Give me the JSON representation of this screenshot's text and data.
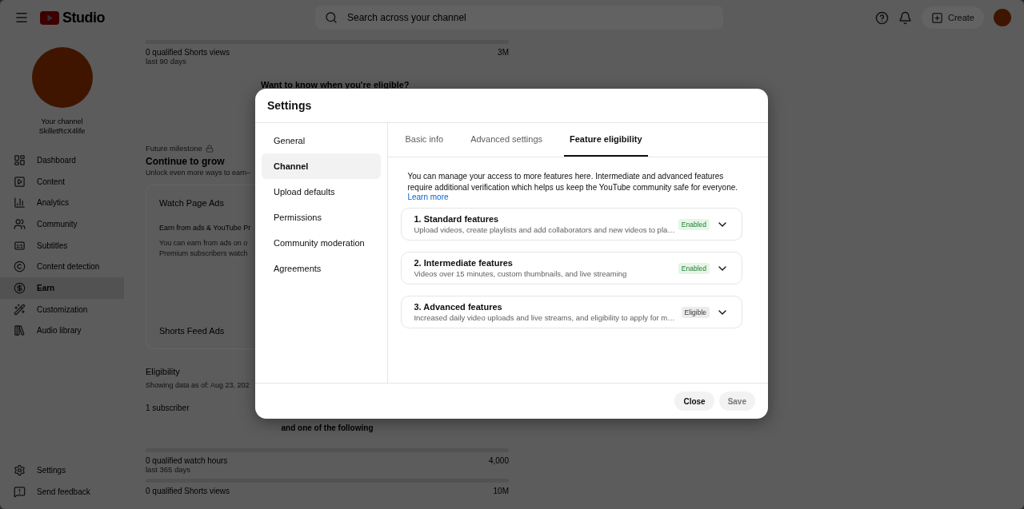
{
  "topbar": {
    "logo": "Studio",
    "search": {
      "placeholder": "Search across your channel"
    },
    "create": "Create"
  },
  "sidebar": {
    "channel_label": "Your channel",
    "channel_handle": "SkilletRcX4life",
    "items": [
      {
        "label": "Dashboard",
        "selected": false
      },
      {
        "label": "Content",
        "selected": false
      },
      {
        "label": "Analytics",
        "selected": false
      },
      {
        "label": "Community",
        "selected": false
      },
      {
        "label": "Subtitles",
        "selected": false
      },
      {
        "label": "Content detection",
        "selected": false
      },
      {
        "label": "Earn",
        "selected": true
      },
      {
        "label": "Customization",
        "selected": false
      },
      {
        "label": "Audio library",
        "selected": false
      }
    ],
    "footer_items": [
      {
        "label": "Settings"
      },
      {
        "label": "Send feedback"
      }
    ]
  },
  "main": {
    "top_metric": {
      "label": "0 qualified Shorts views",
      "period": "last 90 days",
      "target": "3M",
      "level": 0
    },
    "eligible_prompt": "Want to know when you're eligible?",
    "milestone": {
      "kicker": "Future milestone",
      "title": "Continue to grow",
      "subtitle": "Unlock even more ways to earn–"
    },
    "card": {
      "title": "Watch Page Ads",
      "subtitle": "Earn from ads & YouTube Pr",
      "body": [
        "You can earn from ads on o",
        "Premium subscribers watch"
      ],
      "footer": "Shorts Feed Ads"
    },
    "eligibility": {
      "title": "Eligibility",
      "date": "Showing data as of: Aug 23, 202",
      "subscribers": "1 subscriber",
      "separator": "and one of the following",
      "metrics": [
        {
          "label": "0 qualified watch hours",
          "period": "last 365 days",
          "target": "4,000",
          "level": 0
        },
        {
          "label": "0 qualified Shorts views",
          "target": "10M",
          "level": 0
        }
      ]
    }
  },
  "modal": {
    "title": "Settings",
    "nav": [
      {
        "label": "General",
        "selected": false
      },
      {
        "label": "Channel",
        "selected": true
      },
      {
        "label": "Upload defaults",
        "selected": false
      },
      {
        "label": "Permissions",
        "selected": false
      },
      {
        "label": "Community moderation",
        "selected": false
      },
      {
        "label": "Agreements",
        "selected": false
      }
    ],
    "tabs": [
      {
        "label": "Basic info",
        "selected": false
      },
      {
        "label": "Advanced settings",
        "selected": false
      },
      {
        "label": "Feature eligibility",
        "selected": true
      }
    ],
    "description": "You can manage your access to more features here. Intermediate and advanced features require additional verification which helps us keep the YouTube community safe for everyone.",
    "learn_more": "Learn more",
    "features": [
      {
        "title": "1. Standard features",
        "description": "Upload videos, create playlists and add collaborators and new videos to pla…",
        "status": "Enabled",
        "kind": "enabled"
      },
      {
        "title": "2. Intermediate features",
        "description": "Videos over 15 minutes, custom thumbnails, and live streaming",
        "status": "Enabled",
        "kind": "enabled"
      },
      {
        "title": "3. Advanced features",
        "description": "Increased daily video uploads and live streams, and eligibility to apply for m…",
        "status": "Eligible",
        "kind": "eligible"
      }
    ],
    "buttons": [
      {
        "label": "Close",
        "disabled": false
      },
      {
        "label": "Save",
        "disabled": true
      }
    ]
  }
}
